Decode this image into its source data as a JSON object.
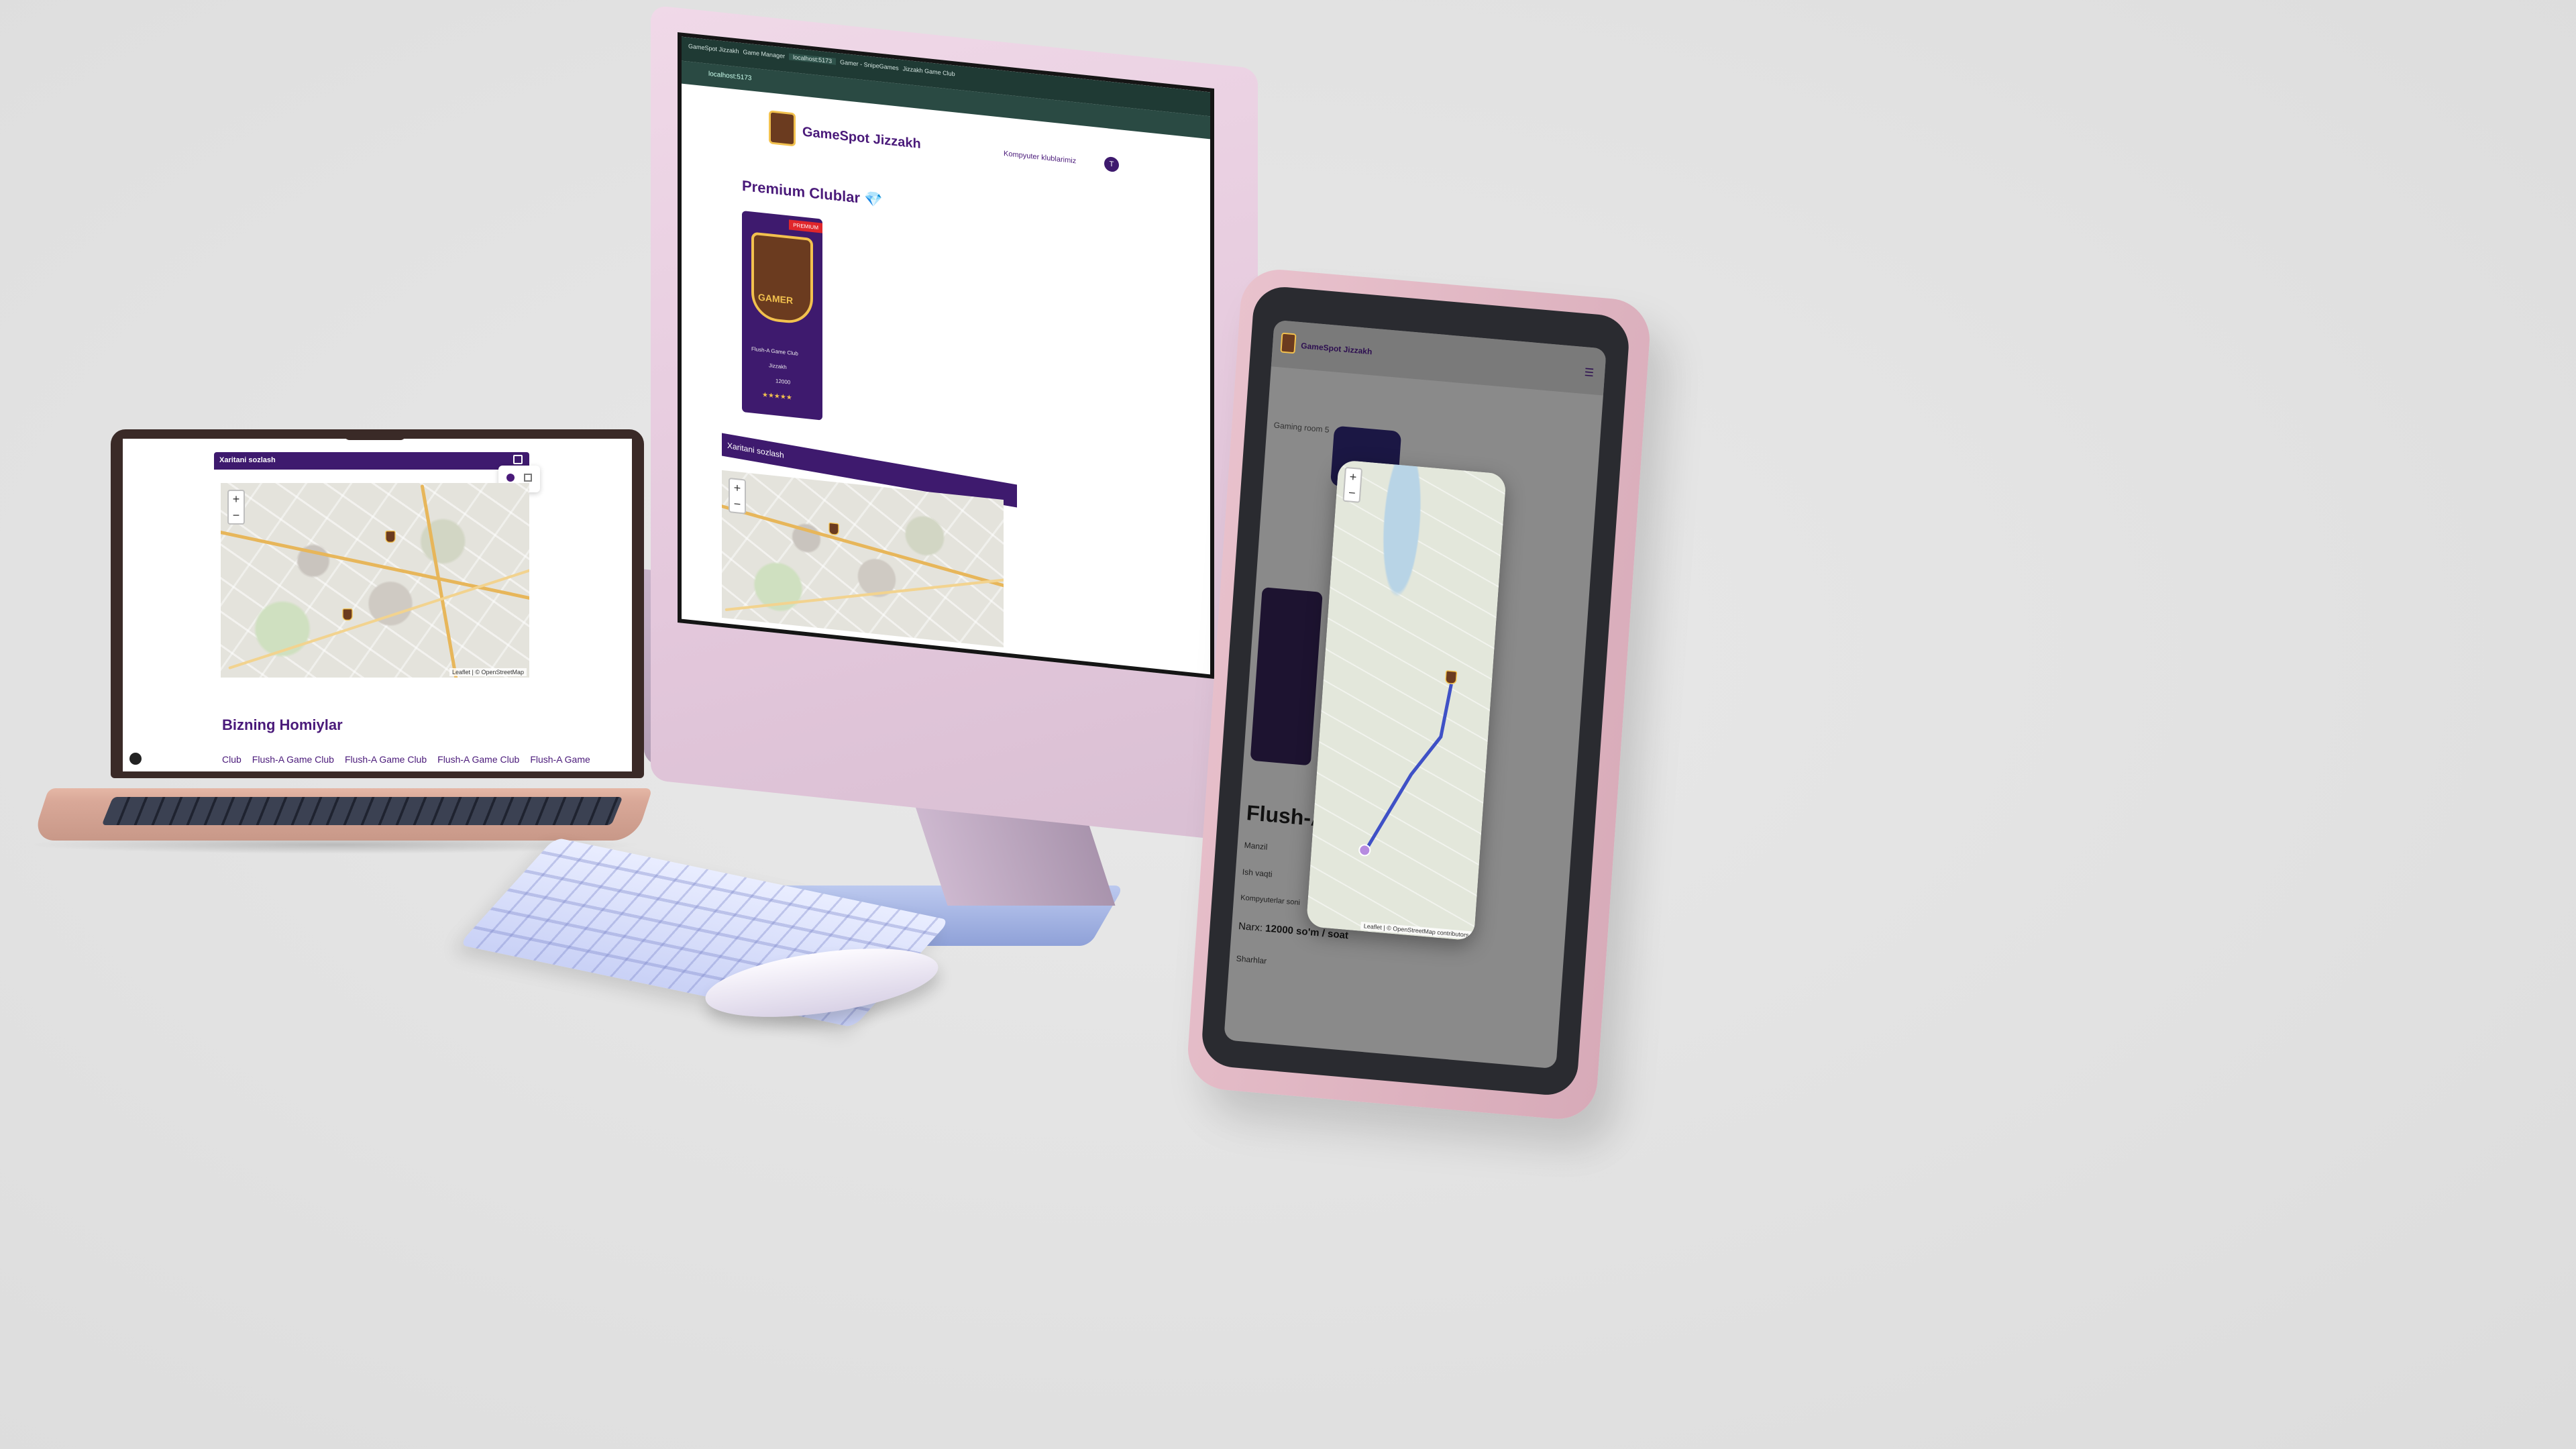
{
  "site": {
    "brand": "GameSpot Jizzakh",
    "nav_link": "Kompyuter klublarimiz",
    "avatar_letter": "T"
  },
  "browser": {
    "tabs": [
      "GameSpot Jizzakh",
      "Game Manager",
      "localhost:5173",
      "Gamer - SnipeGames",
      "Jizzakh Game Club"
    ],
    "url": "localhost:5173"
  },
  "monitor_page": {
    "premium_title": "Premium Clublar 💎",
    "club_card": {
      "badge": "PREMIUM",
      "logo_text": "GAMER",
      "name": "Flush-A Game Club",
      "location": "Jizzakh",
      "price": "12000",
      "stars": "★★★★★"
    },
    "map_panel_title": "Xaritani sozlash"
  },
  "laptop_page": {
    "map_panel_title": "Xaritani sozlash",
    "sponsors_title": "Bizning Homiylar",
    "sponsors": [
      "Club",
      "Flush-A Game Club",
      "Flush-A Game Club",
      "Flush-A Game Club",
      "Flush-A Game"
    ],
    "map_attribution": "Leaflet | © OpenStreetMap"
  },
  "tablet_page": {
    "section_label": "Gaming room 5",
    "club_title": "Flush-A G",
    "address_label": "Manzil",
    "hours_label": "Ish vaqti",
    "computers_label": "Kompyuterlar soni",
    "price_label": "Narx:",
    "price_value": "12000 so'm / soat",
    "reviews_label": "Sharhlar",
    "map_attribution": "Leaflet | © OpenStreetMap contributors"
  },
  "colors": {
    "accent": "#4a1a7a",
    "accent_dark": "#3e1a6e",
    "badge_red": "#e0262b",
    "route_blue": "#3f51c6"
  }
}
